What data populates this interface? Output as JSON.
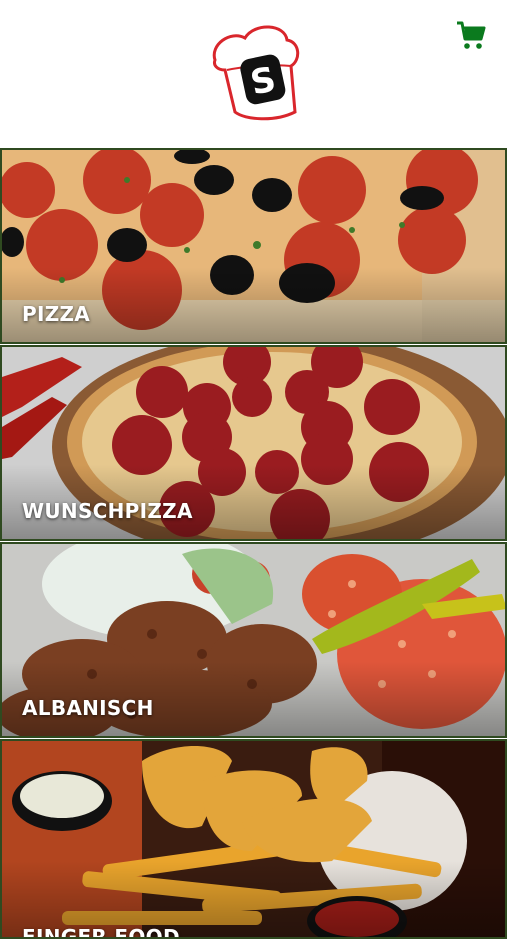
{
  "header": {
    "logo_letter": "S",
    "cart_icon": "shopping-cart-icon",
    "accent_color": "#0b7a1e",
    "logo_color": "#d9262c"
  },
  "categories": [
    {
      "label": "PIZZA"
    },
    {
      "label": "WUNSCHPIZZA"
    },
    {
      "label": "ALBANISCH"
    },
    {
      "label": "FINGER FOOD"
    }
  ]
}
